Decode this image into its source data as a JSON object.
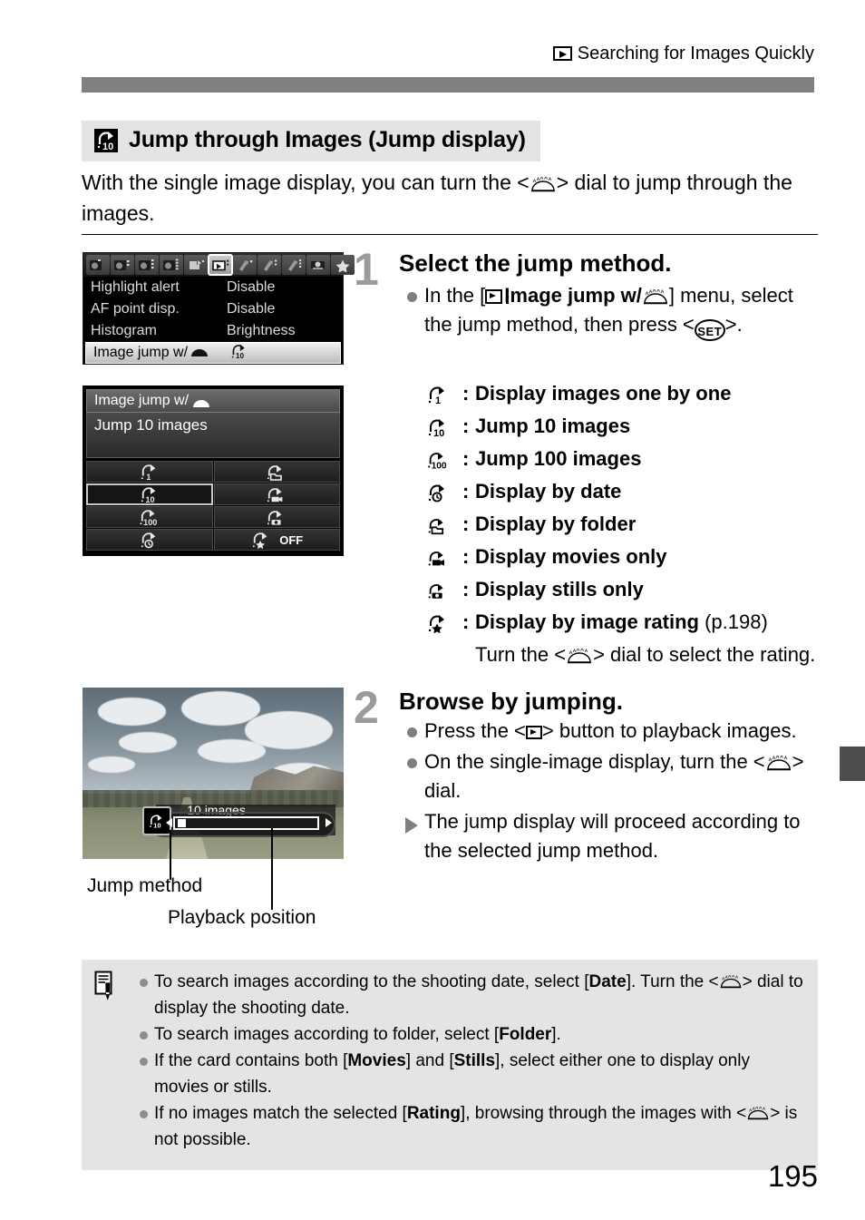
{
  "page": {
    "header_title": "Searching for Images Quickly",
    "header_icon": "playback-icon",
    "page_number": "195",
    "rule_color": "#808080",
    "heading_bg": "#e4e4e4",
    "note_bg": "#e4e4e4",
    "step_number_color": "#9b9b9b"
  },
  "section": {
    "icon": "jump-10-icon",
    "title": "Jump through Images (Jump display)",
    "intro_pre": "With the single image display, you can turn the <",
    "intro_dial": "main-dial-icon",
    "intro_post": "> dial to jump through the images."
  },
  "lcd_menu": {
    "tabs": [
      "shooting-tab-1",
      "shooting-tab-2",
      "shooting-tab-3",
      "shooting-tab-4",
      "playback-tab-1",
      "playback-tab-2",
      "setup-tab-1",
      "setup-tab-2",
      "setup-tab-3",
      "custom-functions-tab",
      "my-menu-tab"
    ],
    "selected_tab_index": 5,
    "rows": [
      {
        "label": "Highlight alert",
        "value": "Disable",
        "selected": false
      },
      {
        "label": "AF point disp.",
        "value": "Disable",
        "selected": false
      },
      {
        "label": "Histogram",
        "value": "Brightness",
        "selected": false
      },
      {
        "label": "Image jump w/",
        "value": "",
        "value_icon": "jump-10-icon",
        "label_icon": "main-dial-icon",
        "selected": true
      }
    ]
  },
  "lcd_jump": {
    "title": "Image jump w/",
    "title_icon": "main-dial-icon",
    "current_value": "Jump 10 images",
    "options": [
      {
        "icon": "jump-1-icon",
        "label": "",
        "selected": false
      },
      {
        "icon": "jump-folder-icon",
        "label": "",
        "selected": false
      },
      {
        "icon": "jump-10-icon",
        "label": "",
        "selected": true
      },
      {
        "icon": "jump-movies-icon",
        "label": "",
        "selected": false
      },
      {
        "icon": "jump-100-icon",
        "label": "",
        "selected": false
      },
      {
        "icon": "jump-stills-icon",
        "label": "",
        "selected": false
      },
      {
        "icon": "jump-date-icon",
        "label": "",
        "selected": false
      },
      {
        "icon": "jump-rating-icon",
        "label": "OFF",
        "selected": false
      }
    ]
  },
  "photo": {
    "overlay_label": "10 images",
    "overlay_icon": "jump-10-icon",
    "caption_jump_method": "Jump method",
    "caption_playback_position": "Playback position"
  },
  "steps": [
    {
      "number": "1",
      "title": "Select the jump method.",
      "bullets": [
        {
          "type": "dot",
          "parts": [
            {
              "t": "text",
              "v": "In the ["
            },
            {
              "t": "icon",
              "v": "playback-menu-icon"
            },
            {
              "t": "bold",
              "v": "Image jump w/"
            },
            {
              "t": "icon",
              "v": "main-dial-icon"
            },
            {
              "t": "text",
              "v": "] menu, select the jump method, then press <"
            },
            {
              "t": "icon",
              "v": "set-button-icon"
            },
            {
              "t": "text",
              "v": ">."
            }
          ]
        }
      ],
      "jump_methods": [
        {
          "icon": "jump-1-icon",
          "label": "Display images one by one",
          "note": ""
        },
        {
          "icon": "jump-10-icon",
          "label": "Jump 10 images",
          "note": ""
        },
        {
          "icon": "jump-100-icon",
          "label": "Jump 100 images",
          "note": ""
        },
        {
          "icon": "jump-date-icon",
          "label": "Display by date",
          "note": ""
        },
        {
          "icon": "jump-folder-icon",
          "label": "Display by folder",
          "note": ""
        },
        {
          "icon": "jump-movies-icon",
          "label": "Display movies only",
          "note": ""
        },
        {
          "icon": "jump-stills-icon",
          "label": "Display stills only",
          "note": ""
        },
        {
          "icon": "jump-rating-icon",
          "label": "Display by image rating",
          "note": " (p.198)"
        }
      ],
      "jump_methods_sub_pre": "Turn the <",
      "jump_methods_sub_icon": "main-dial-icon",
      "jump_methods_sub_post": "> dial to select the rating."
    },
    {
      "number": "2",
      "title": "Browse by jumping.",
      "bullets": [
        {
          "type": "dot",
          "parts": [
            {
              "t": "text",
              "v": "Press the <"
            },
            {
              "t": "icon",
              "v": "playback-button-icon"
            },
            {
              "t": "text",
              "v": "> button to playback images."
            }
          ]
        },
        {
          "type": "dot",
          "parts": [
            {
              "t": "text",
              "v": "On the single-image display, turn the <"
            },
            {
              "t": "icon",
              "v": "main-dial-icon"
            },
            {
              "t": "text",
              "v": "> dial."
            }
          ]
        },
        {
          "type": "triangle",
          "parts": [
            {
              "t": "text",
              "v": "The jump display will proceed according to the selected jump method."
            }
          ]
        }
      ]
    }
  ],
  "notes": {
    "icon": "note-pencil-icon",
    "items": [
      {
        "parts": [
          {
            "t": "text",
            "v": "To search images according to the shooting date, select ["
          },
          {
            "t": "bold",
            "v": "Date"
          },
          {
            "t": "text",
            "v": "]. Turn the <"
          },
          {
            "t": "icon",
            "v": "main-dial-icon"
          },
          {
            "t": "text",
            "v": "> dial to display the shooting date."
          }
        ]
      },
      {
        "parts": [
          {
            "t": "text",
            "v": "To search images according to folder, select ["
          },
          {
            "t": "bold",
            "v": "Folder"
          },
          {
            "t": "text",
            "v": "]."
          }
        ]
      },
      {
        "parts": [
          {
            "t": "text",
            "v": "If the card contains both ["
          },
          {
            "t": "bold",
            "v": "Movies"
          },
          {
            "t": "text",
            "v": "] and ["
          },
          {
            "t": "bold",
            "v": "Stills"
          },
          {
            "t": "text",
            "v": "], select either one to display only movies or stills."
          }
        ]
      },
      {
        "parts": [
          {
            "t": "text",
            "v": "If no images match the selected ["
          },
          {
            "t": "bold",
            "v": "Rating"
          },
          {
            "t": "text",
            "v": "], browsing through the images with <"
          },
          {
            "t": "icon",
            "v": "main-dial-icon"
          },
          {
            "t": "text",
            "v": "> is not possible."
          }
        ]
      }
    ]
  }
}
